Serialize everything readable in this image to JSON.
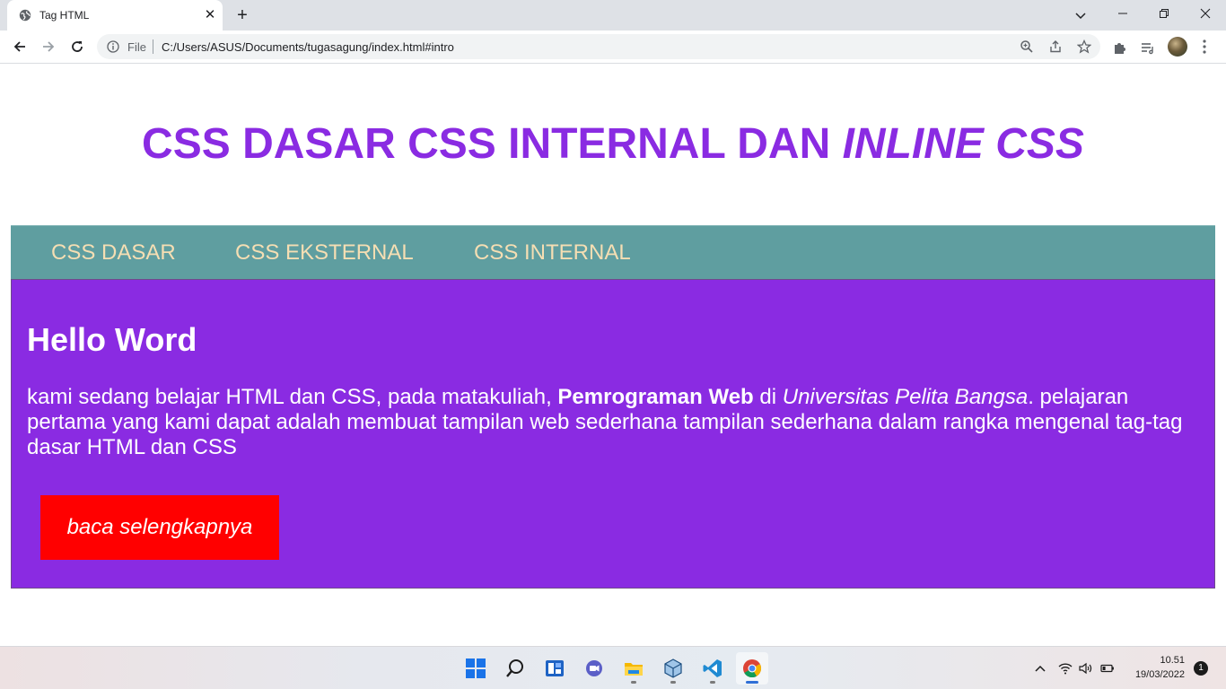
{
  "browser": {
    "tab_title": "Tag HTML",
    "tab_close_glyph": "✕",
    "new_tab_glyph": "+",
    "scheme_label": "File",
    "url": "C:/Users/ASUS/Documents/tugasagung/index.html#intro",
    "icons": [
      "back-icon",
      "forward-icon",
      "reload-icon",
      "info-icon",
      "zoom-icon",
      "share-icon",
      "star-icon",
      "extensions-icon",
      "reading-list-icon",
      "menu-icon"
    ]
  },
  "page": {
    "title_main": "CSS DASAR CSS INTERNAL DAN ",
    "title_italic": "INLINE CSS",
    "nav": {
      "items": [
        {
          "label": "CSS DASAR"
        },
        {
          "label": "CSS EKSTERNAL"
        },
        {
          "label": "CSS INTERNAL"
        }
      ]
    },
    "content": {
      "heading": "Hello Word",
      "para_part1": "kami sedang belajar HTML dan CSS, pada matakuliah, ",
      "para_bold": "Pemrograman Web",
      "para_part2": " di ",
      "para_italic": "Universitas Pelita Bangsa",
      "para_part3": ". pelajaran pertama yang kami dapat adalah membuat tampilan web sederhana tampilan sederhana dalam rangka mengenal tag-tag dasar HTML dan CSS",
      "button_label": "baca selengkapnya"
    },
    "colors": {
      "title": "#8a2be2",
      "navbar_bg": "#5f9ea0",
      "nav_text": "#f5deb3",
      "content_bg": "#8a2be2",
      "button_bg": "#ff0000"
    }
  },
  "taskbar": {
    "apps": [
      "start-icon",
      "search-icon",
      "widgets-icon",
      "chat-icon",
      "file-explorer-icon",
      "virtualbox-icon",
      "vscode-icon",
      "chrome-icon"
    ],
    "time": "10.51",
    "date": "19/03/2022",
    "notification_count": "1"
  }
}
